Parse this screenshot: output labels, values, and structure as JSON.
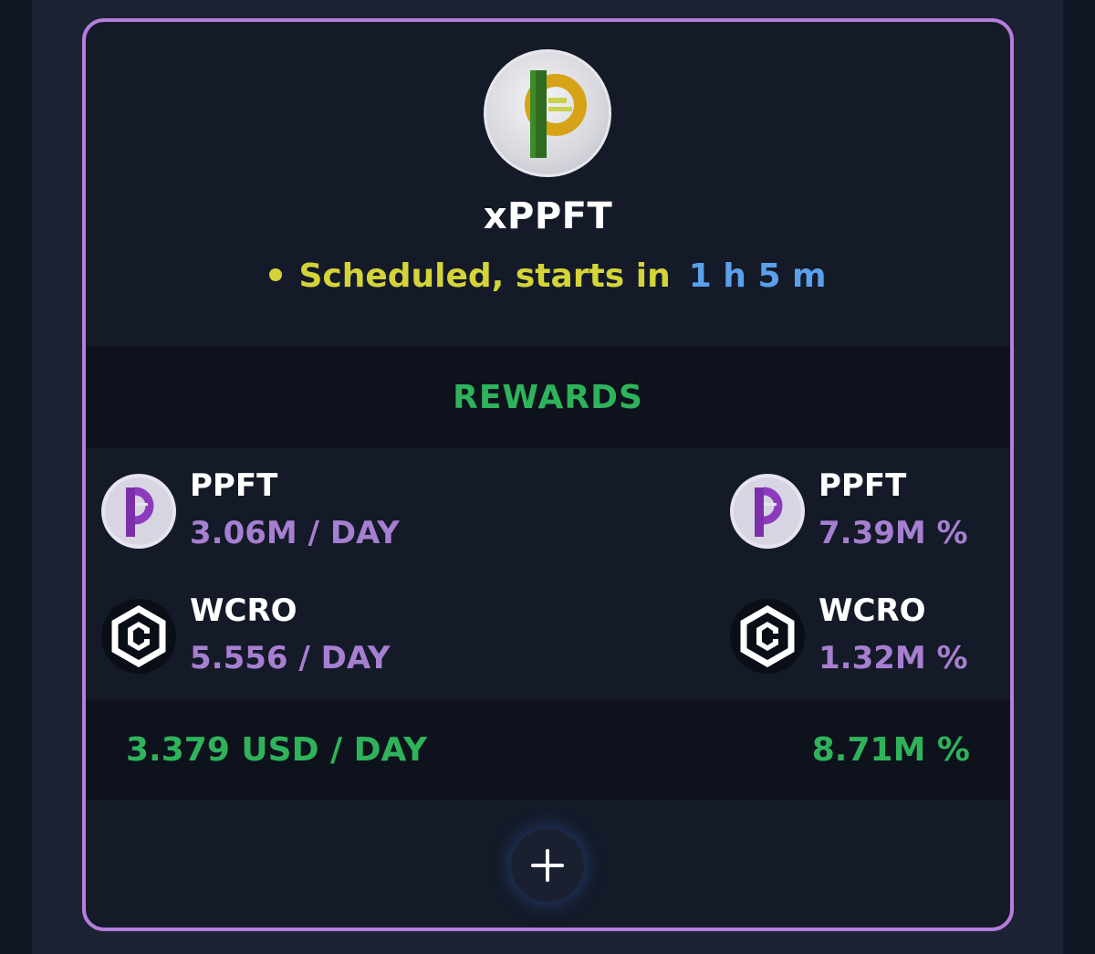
{
  "card": {
    "token_name": "xPPFT",
    "token_logo_icon": "ppft-logo-icon",
    "status": {
      "label": "Scheduled, starts in",
      "time": "1 h 5 m",
      "color": "#d4d43a",
      "time_color": "#5aa0ea"
    },
    "border_color": "#b57edc"
  },
  "rewards": {
    "title": "REWARDS",
    "items": [
      {
        "token": "PPFT",
        "value": "3.06M / DAY",
        "icon": "ppft-purple-icon"
      },
      {
        "token": "PPFT",
        "value": "7.39M %",
        "icon": "ppft-purple-icon"
      },
      {
        "token": "WCRO",
        "value": "5.556 / DAY",
        "icon": "wcro-icon"
      },
      {
        "token": "WCRO",
        "value": "1.32M %",
        "icon": "wcro-icon"
      }
    ],
    "total_per_day": "3.379 USD / DAY",
    "total_percent": "8.71M %",
    "accent_color": "#2fb35a",
    "value_color": "#a67fd0"
  },
  "actions": {
    "add_icon": "plus-icon"
  }
}
